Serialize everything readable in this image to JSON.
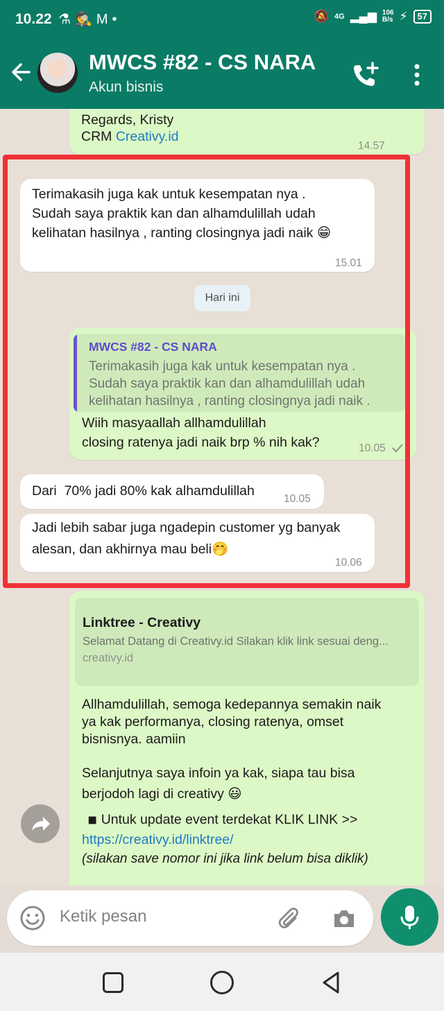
{
  "status_bar": {
    "time": "10.22",
    "left_icons": [
      "flask-icon",
      "incognito-icon",
      "gmail-icon",
      "dot-icon"
    ],
    "network": "4G",
    "speed": "106\nB/s",
    "battery": "57"
  },
  "header": {
    "title": "MWCS #82 - CS NARA",
    "subtitle": "Akun bisnis",
    "bg_color": "#0a7b65"
  },
  "messages": {
    "top_regards": "Regards, Kristy",
    "top_crm_prefix": "CRM ",
    "top_crm_link": "Creativy.id",
    "top_time": "14.57",
    "m1_line1": "Terimakasih juga kak untuk kesempatan nya .",
    "m1_line2": "Sudah saya praktik kan dan alhamdulillah udah",
    "m1_line3": "kelihatan hasilnya , ranting closingnya jadi naik 😁",
    "m1_time": "15.01",
    "date_chip": "Hari ini",
    "quote_name": "MWCS #82 - CS NARA",
    "quote_line1": "Terimakasih juga kak untuk kesempatan nya .",
    "quote_line2": "Sudah saya praktik kan dan alhamdulillah udah",
    "quote_line3": "kelihatan hasilnya , ranting closingnya jadi naik .",
    "m2_line1": "Wiih masyaallah allhamdulillah",
    "m2_line2": "closing ratenya jadi naik brp % nih kak?",
    "m2_time": "10.05",
    "m3_text": "Dari  70% jadi 80% kak alhamdulillah",
    "m3_time": "10.05",
    "m4_line1": "Jadi lebih sabar juga ngadepin customer yg banyak",
    "m4_line2": "alesan, dan akhirnya mau beli🤭",
    "m4_time": "10.06",
    "preview_title": "Linktree - Creativy",
    "preview_desc": "Selamat Datang di Creativy.id Silakan klik link sesuai deng...",
    "preview_domain": "creativy.id",
    "m5_line1": "Allhamdulillah, semoga kedepannya semakin naik",
    "m5_line2": "ya kak performanya, closing ratenya, omset",
    "m5_line3": "bisnisnya. aamiin",
    "m5_line4": "Selanjutnya saya infoin ya kak, siapa tau bisa",
    "m5_line5": "berjodoh lagi di creativy 😃",
    "m5_line6": "◾ Untuk update event terdekat KLIK LINK >>",
    "m5_link": "https://creativy.id/linktree/",
    "m5_note": "(silakan save nomor ini jika link belum bisa diklik)"
  },
  "input": {
    "placeholder": "Ketik pesan"
  },
  "colors": {
    "incoming": "#ffffff",
    "outgoing": "#dcf8c6",
    "highlight": "#ef3136",
    "link": "#1e7bc4",
    "mic": "#0f8f6e"
  }
}
